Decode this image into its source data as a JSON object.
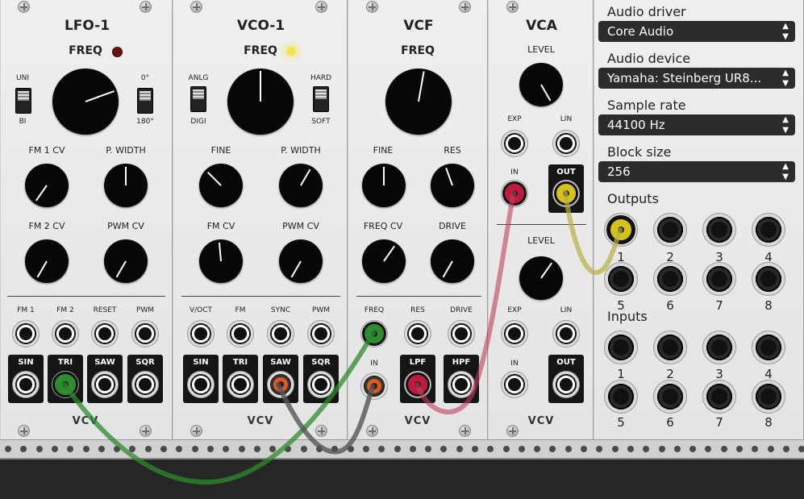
{
  "modules": {
    "lfo": {
      "title": "LFO-1",
      "freq_label": "FREQ",
      "switch1_top": "UNI",
      "switch1_bottom": "BI",
      "switch2_top": "0°",
      "switch2_bottom": "180°",
      "k1": "FM 1 CV",
      "k2": "P. WIDTH",
      "k3": "FM 2 CV",
      "k4": "PWM CV",
      "in1": "FM 1",
      "in2": "FM 2",
      "in3": "RESET",
      "in4": "PWM",
      "out1": "SIN",
      "out2": "TRI",
      "out3": "SAW",
      "out4": "SQR",
      "logo": "VCV"
    },
    "vco": {
      "title": "VCO-1",
      "freq_label": "FREQ",
      "switch1_top": "ANLG",
      "switch1_bottom": "DIGI",
      "switch2_top": "HARD",
      "switch2_bottom": "SOFT",
      "k1": "FINE",
      "k2": "P. WIDTH",
      "k3": "FM CV",
      "k4": "PWM CV",
      "in1": "V/OCT",
      "in2": "FM",
      "in3": "SYNC",
      "in4": "PWM",
      "out1": "SIN",
      "out2": "TRI",
      "out3": "SAW",
      "out4": "SQR",
      "logo": "VCV"
    },
    "vcf": {
      "title": "VCF",
      "freq_label": "FREQ",
      "k1": "FINE",
      "k2": "RES",
      "k3": "FREQ CV",
      "k4": "DRIVE",
      "in1": "FREQ",
      "in2": "RES",
      "in3": "DRIVE",
      "in4": "IN",
      "out1": "LPF",
      "out2": "HPF",
      "logo": "VCV"
    },
    "vca": {
      "title": "VCA",
      "level1": "LEVEL",
      "exp1": "EXP",
      "lin1": "LIN",
      "in1": "IN",
      "out1": "OUT",
      "level2": "LEVEL",
      "exp2": "EXP",
      "lin2": "LIN",
      "in2": "IN",
      "out2": "OUT",
      "logo": "VCV"
    }
  },
  "audio": {
    "driver_label": "Audio driver",
    "driver_value": "Core Audio",
    "device_label": "Audio device",
    "device_value": "Yamaha: Steinberg UR8...",
    "rate_label": "Sample rate",
    "rate_value": "44100 Hz",
    "block_label": "Block size",
    "block_value": "256",
    "outputs_label": "Outputs",
    "inputs_label": "Inputs",
    "outputs": [
      "1",
      "2",
      "3",
      "4",
      "5",
      "6",
      "7",
      "8"
    ],
    "inputs": [
      "1",
      "2",
      "3",
      "4",
      "5",
      "6",
      "7",
      "8"
    ],
    "select_arrows": "▲▼"
  },
  "colors": {
    "cable_green": "#2e8b2e",
    "cable_gray": "#5a5a5a",
    "cable_red": "#c0405a",
    "cable_yellow": "#b8b040",
    "led_red": "#6a1010",
    "led_yellow": "#f3e34a"
  }
}
